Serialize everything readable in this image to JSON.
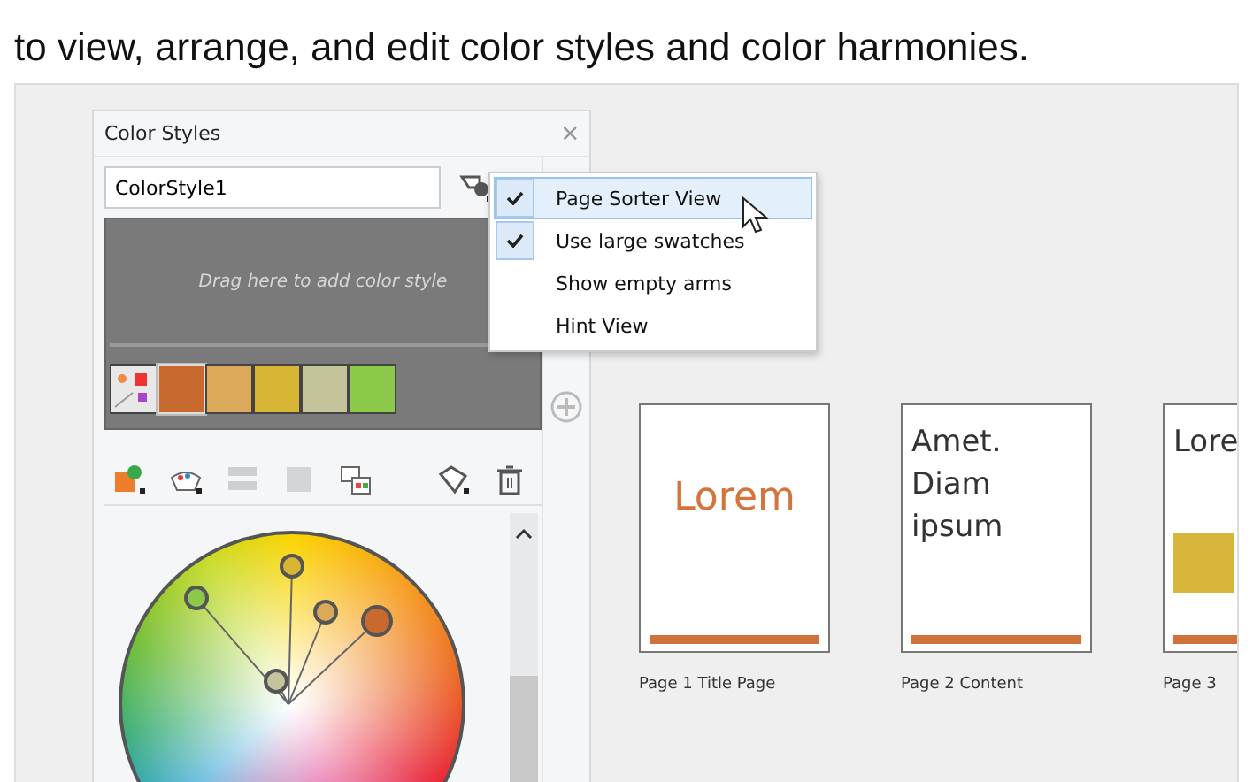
{
  "caption": "to view, arrange, and edit color styles and color harmonies.",
  "panel": {
    "title": "Color Styles",
    "close": "×",
    "style_name": "ColorStyle1",
    "drop_hint": "Drag here to add color style",
    "swatches": [
      {
        "kind": "harmony",
        "selected": false,
        "color": "#e8e8e8"
      },
      {
        "kind": "color",
        "selected": true,
        "color": "#c8692f"
      },
      {
        "kind": "color",
        "selected": false,
        "color": "#dba95a"
      },
      {
        "kind": "color",
        "selected": false,
        "color": "#d8b534"
      },
      {
        "kind": "color",
        "selected": false,
        "color": "#c3c49c"
      },
      {
        "kind": "color",
        "selected": false,
        "color": "#8cc94a"
      }
    ],
    "toolbar": [
      {
        "kind": "new-style",
        "disabled": false
      },
      {
        "kind": "harmony",
        "disabled": false
      },
      {
        "kind": "convert",
        "disabled": true
      },
      {
        "kind": "group",
        "disabled": true
      },
      {
        "kind": "import",
        "disabled": false
      },
      {
        "kind": "edit",
        "disabled": false
      },
      {
        "kind": "delete",
        "disabled": false
      }
    ]
  },
  "menu": [
    {
      "label": "Page Sorter View",
      "checked": true,
      "selected": true
    },
    {
      "label": "Use large swatches",
      "checked": true,
      "selected": false
    },
    {
      "label": "Show empty arms",
      "checked": false,
      "selected": false
    },
    {
      "label": "Hint View",
      "checked": false,
      "selected": false
    }
  ],
  "pages": [
    {
      "kind": "title",
      "text": "Lorem",
      "label": "Page 1 Title Page"
    },
    {
      "kind": "content",
      "text": "Amet. Diam ipsum",
      "label": "Page 2 Content"
    },
    {
      "kind": "block",
      "text": "Lore",
      "label": "Page 3"
    }
  ]
}
